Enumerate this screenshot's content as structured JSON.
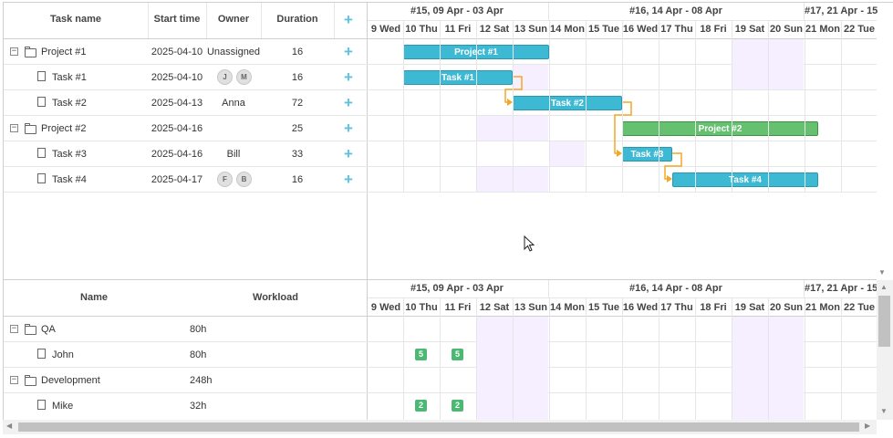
{
  "grid": {
    "columns": {
      "task_name": "Task name",
      "start_time": "Start time",
      "owner": "Owner",
      "duration": "Duration"
    },
    "rows": [
      {
        "name": "Project #1",
        "start": "2025-04-10",
        "owner": "Unassigned",
        "duration": "16"
      },
      {
        "name": "Task #1",
        "start": "2025-04-10",
        "owner_avatars": [
          "J",
          "M"
        ],
        "duration": "16"
      },
      {
        "name": "Task #2",
        "start": "2025-04-13",
        "owner": "Anna",
        "duration": "72"
      },
      {
        "name": "Project #2",
        "start": "2025-04-16",
        "owner": "",
        "duration": "25"
      },
      {
        "name": "Task #3",
        "start": "2025-04-16",
        "owner": "Bill",
        "duration": "33"
      },
      {
        "name": "Task #4",
        "start": "2025-04-17",
        "owner_avatars": [
          "F",
          "B"
        ],
        "duration": "16"
      }
    ]
  },
  "timeline": {
    "weeks": [
      "#15, 09 Apr - 03 Apr",
      "#16, 14 Apr - 08 Apr",
      "#17, 21 Apr - 15"
    ],
    "days": [
      "9 Wed",
      "10 Thu",
      "11 Fri",
      "12 Sat",
      "13 Sun",
      "14 Mon",
      "15 Tue",
      "16 Wed",
      "17 Thu",
      "18 Fri",
      "19 Sat",
      "20 Sun",
      "21 Mon",
      "22 Tue"
    ],
    "bars": {
      "project1": "Project #1",
      "task1": "Task #1",
      "task2": "Task #2",
      "project2": "Project #2",
      "task3": "Task #3",
      "task4": "Task #4"
    }
  },
  "resources": {
    "columns": {
      "name": "Name",
      "workload": "Workload"
    },
    "rows": [
      {
        "name": "QA",
        "workload": "80h"
      },
      {
        "name": "John",
        "workload": "80h"
      },
      {
        "name": "Development",
        "workload": "248h"
      },
      {
        "name": "Mike",
        "workload": "32h"
      }
    ],
    "loads": {
      "john_10": "5",
      "john_11": "5",
      "mike_10": "2",
      "mike_11": "2"
    }
  },
  "colors": {
    "task_bar": "#3db9d3",
    "project_bar": "#65c16f",
    "weekend": "#f6efff",
    "load_badge": "#4bb873",
    "link": "#f5a623",
    "add_icon": "#5ec3dd"
  },
  "icons": [
    "folder-icon",
    "file-icon",
    "collapse-icon",
    "add-icon",
    "mouse-cursor-icon",
    "scroll-arrow-icon"
  ]
}
